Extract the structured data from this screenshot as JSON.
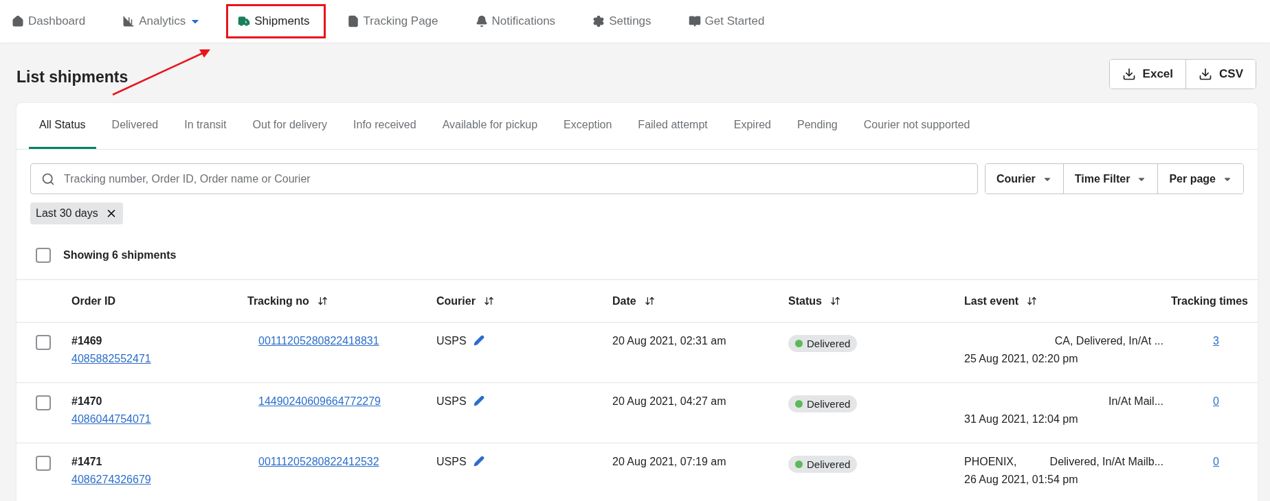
{
  "nav": [
    {
      "label": "Dashboard",
      "selected": false,
      "dropdown": false,
      "annotated": false
    },
    {
      "label": "Analytics",
      "selected": false,
      "dropdown": true,
      "annotated": false
    },
    {
      "label": "Shipments",
      "selected": true,
      "dropdown": false,
      "annotated": true
    },
    {
      "label": "Tracking Page",
      "selected": false,
      "dropdown": false,
      "annotated": false
    },
    {
      "label": "Notifications",
      "selected": false,
      "dropdown": false,
      "annotated": false
    },
    {
      "label": "Settings",
      "selected": false,
      "dropdown": false,
      "annotated": false
    },
    {
      "label": "Get Started",
      "selected": false,
      "dropdown": false,
      "annotated": false
    }
  ],
  "page_title": "List shipments",
  "export_buttons": [
    "Excel",
    "CSV"
  ],
  "status_tabs": [
    {
      "label": "All Status",
      "selected": true
    },
    {
      "label": "Delivered",
      "selected": false
    },
    {
      "label": "In transit",
      "selected": false
    },
    {
      "label": "Out for delivery",
      "selected": false
    },
    {
      "label": "Info received",
      "selected": false
    },
    {
      "label": "Available for pickup",
      "selected": false
    },
    {
      "label": "Exception",
      "selected": false
    },
    {
      "label": "Failed attempt",
      "selected": false
    },
    {
      "label": "Expired",
      "selected": false
    },
    {
      "label": "Pending",
      "selected": false
    },
    {
      "label": "Courier not supported",
      "selected": false
    }
  ],
  "search": {
    "placeholder": "Tracking number, Order ID, Order name or Courier"
  },
  "filters": [
    "Courier",
    "Time Filter",
    "Per page"
  ],
  "active_filter": "Last 30 days",
  "select_all": {
    "checked": false,
    "label": "Showing 6 shipments"
  },
  "table": {
    "columns": [
      {
        "label": "Order ID",
        "sortable": false
      },
      {
        "label": "Tracking no",
        "sortable": true
      },
      {
        "label": "Courier",
        "sortable": true
      },
      {
        "label": "Date",
        "sortable": true
      },
      {
        "label": "Status",
        "sortable": true
      },
      {
        "label": "Last event",
        "sortable": true
      },
      {
        "label": "Tracking times",
        "sortable": false
      }
    ],
    "rows": [
      {
        "checked": false,
        "order": "#1469",
        "order_number": "4085882552471",
        "tracking_no": "00111205280822418831",
        "courier": "USPS",
        "date": "20 Aug 2021, 02:31 am",
        "status": "Delivered",
        "color": "#5cb85c",
        "event_location": "",
        "event": "CA, Delivered, In/At ...",
        "event_time": "25 Aug 2021, 02:20 pm",
        "tracking_times": "3"
      },
      {
        "checked": false,
        "order": "#1470",
        "order_number": "4086044754071",
        "tracking_no": "14490240609664772279",
        "courier": "USPS",
        "date": "20 Aug 2021, 04:27 am",
        "status": "Delivered",
        "color": "#5cb85c",
        "event_location": "",
        "event": "In/At Mail...",
        "event_time": "31 Aug 2021, 12:04 pm",
        "tracking_times": "0"
      },
      {
        "checked": false,
        "order": "#1471",
        "order_number": "4086274326679",
        "tracking_no": "00111205280822412532",
        "courier": "USPS",
        "date": "20 Aug 2021, 07:19 am",
        "status": "Delivered",
        "color": "#5cb85c",
        "event_location": "PHOENIX,",
        "event": "Delivered, In/At Mailb...",
        "event_time": "26 Aug 2021, 01:54 pm",
        "tracking_times": "0"
      }
    ]
  }
}
